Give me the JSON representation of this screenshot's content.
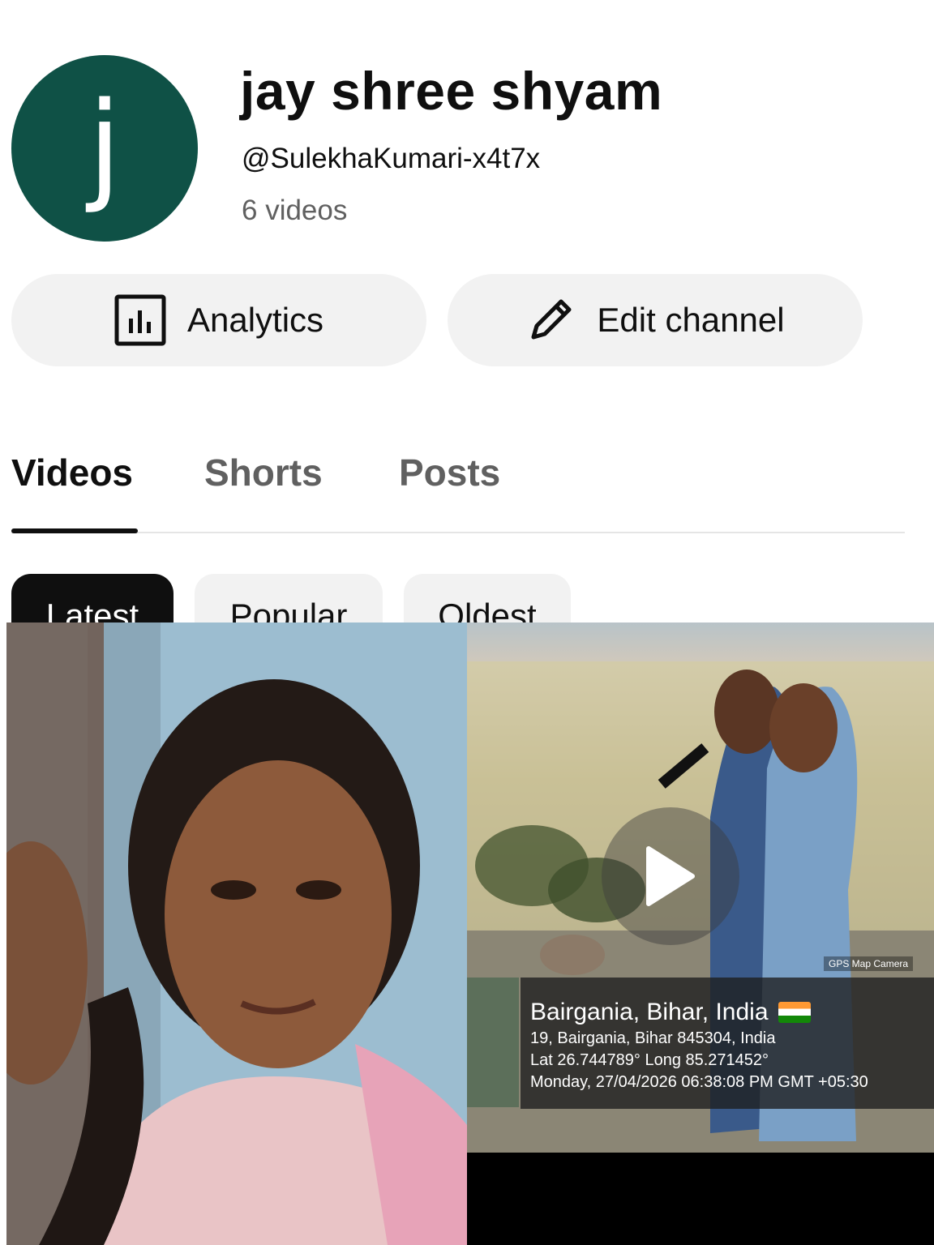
{
  "channel": {
    "avatar_letter": "j",
    "name": "jay shree shyam",
    "handle": "@SulekhaKumari-x4t7x",
    "video_count": "6 videos"
  },
  "actions": {
    "analytics_label": "Analytics",
    "edit_label": "Edit channel"
  },
  "tabs": [
    {
      "label": "Videos",
      "selected": true
    },
    {
      "label": "Shorts",
      "selected": false
    },
    {
      "label": "Posts",
      "selected": false
    }
  ],
  "filters": [
    {
      "label": "Latest",
      "selected": true
    },
    {
      "label": "Popular",
      "selected": false
    },
    {
      "label": "Oldest",
      "selected": false
    }
  ],
  "videos": [
    {
      "thumbnail": "selfie-photo"
    },
    {
      "thumbnail": "outdoor-singing",
      "overlay": {
        "app_label": "GPS Map Camera",
        "place": "Bairgania, Bihar, India",
        "address": "19, Bairgania, Bihar 845304, India",
        "coords": "Lat 26.744789° Long 85.271452°",
        "datetime": "Monday, 27/04/2026 06:38:08 PM GMT +05:30"
      }
    }
  ],
  "colors": {
    "avatar_bg": "#0f5146",
    "pill_bg": "#f2f2f2",
    "chip_selected_bg": "#0f0f0f",
    "secondary_text": "#606060"
  }
}
